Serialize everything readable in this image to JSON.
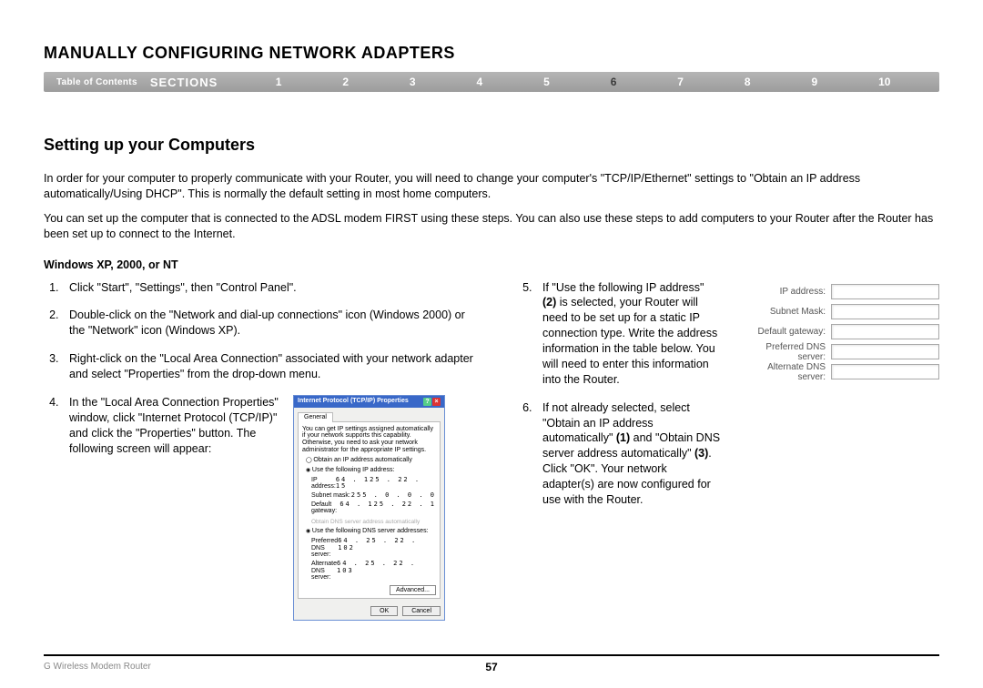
{
  "header": {
    "title": "MANUALLY CONFIGURING NETWORK ADAPTERS"
  },
  "nav": {
    "toc": "Table of Contents",
    "sections_label": "SECTIONS",
    "items": [
      "1",
      "2",
      "3",
      "4",
      "5",
      "6",
      "7",
      "8",
      "9",
      "10"
    ],
    "active": "6"
  },
  "heading": "Setting up your Computers",
  "intro": {
    "p1": "In order for your computer to properly communicate with your Router, you will need to change your computer's \"TCP/IP/Ethernet\" settings to \"Obtain an IP address automatically/Using DHCP\". This is normally the default setting in most home computers.",
    "p2": "You can set up the computer that is connected to the ADSL modem FIRST using these steps. You can also use these steps to add computers to your Router after the Router has been set up to connect to the Internet."
  },
  "os_heading": "Windows XP, 2000, or NT",
  "steps_left": {
    "s1": "Click \"Start\", \"Settings\", then \"Control Panel\".",
    "s2": "Double-click on the \"Network and dial-up connections\" icon (Windows 2000) or the \"Network\" icon (Windows XP).",
    "s3": "Right-click on the \"Local Area Connection\" associated with your network adapter and select \"Properties\" from the drop-down menu.",
    "s4": "In the \"Local Area Connection Properties\" window, click \"Internet Protocol (TCP/IP)\" and click the \"Properties\" button. The following screen will appear:"
  },
  "steps_right": {
    "s5_a": "If \"Use the following IP address\" ",
    "s5_b": "(2)",
    "s5_c": " is selected, your Router will need to be set up for a static IP connection type. Write the address information in the table below. You will need to enter this information into the Router.",
    "s6_a": "If not already selected, select \"Obtain an IP address automatically\" ",
    "s6_b": "(1)",
    "s6_c": " and \"Obtain DNS server address automatically\" ",
    "s6_d": "(3)",
    "s6_e": ". Click \"OK\". Your network adapter(s) are now configured for use with the Router."
  },
  "dialog": {
    "title": "Internet Protocol (TCP/IP) Properties",
    "tab": "General",
    "desc": "You can get IP settings assigned automatically if your network supports this capability. Otherwise, you need to ask your network administrator for the appropriate IP settings.",
    "r1": "Obtain an IP address automatically",
    "r2": "Use the following IP address:",
    "f_ip": "IP address:",
    "f_sm": "Subnet mask:",
    "f_gw": "Default gateway:",
    "gray": "Obtain DNS server address automatically",
    "r3": "Use the following DNS server addresses:",
    "f_pdns": "Preferred DNS server:",
    "f_adns": "Alternate DNS server:",
    "v_ip": "64 . 125 . 22 . 15",
    "v_sm": "255 . 0 . 0 . 0",
    "v_gw": "64 . 125 . 22 . 1",
    "v_pdns": "64 . 25 . 22 . 102",
    "v_adns": "64 . 25 . 22 . 103",
    "adv": "Advanced...",
    "ok": "OK",
    "cancel": "Cancel"
  },
  "ip_table": {
    "r1": "IP address:",
    "r2": "Subnet Mask:",
    "r3": "Default gateway:",
    "r4": "Preferred DNS server:",
    "r5": "Alternate DNS server:"
  },
  "footer": {
    "product": "G Wireless Modem Router",
    "page": "57"
  }
}
